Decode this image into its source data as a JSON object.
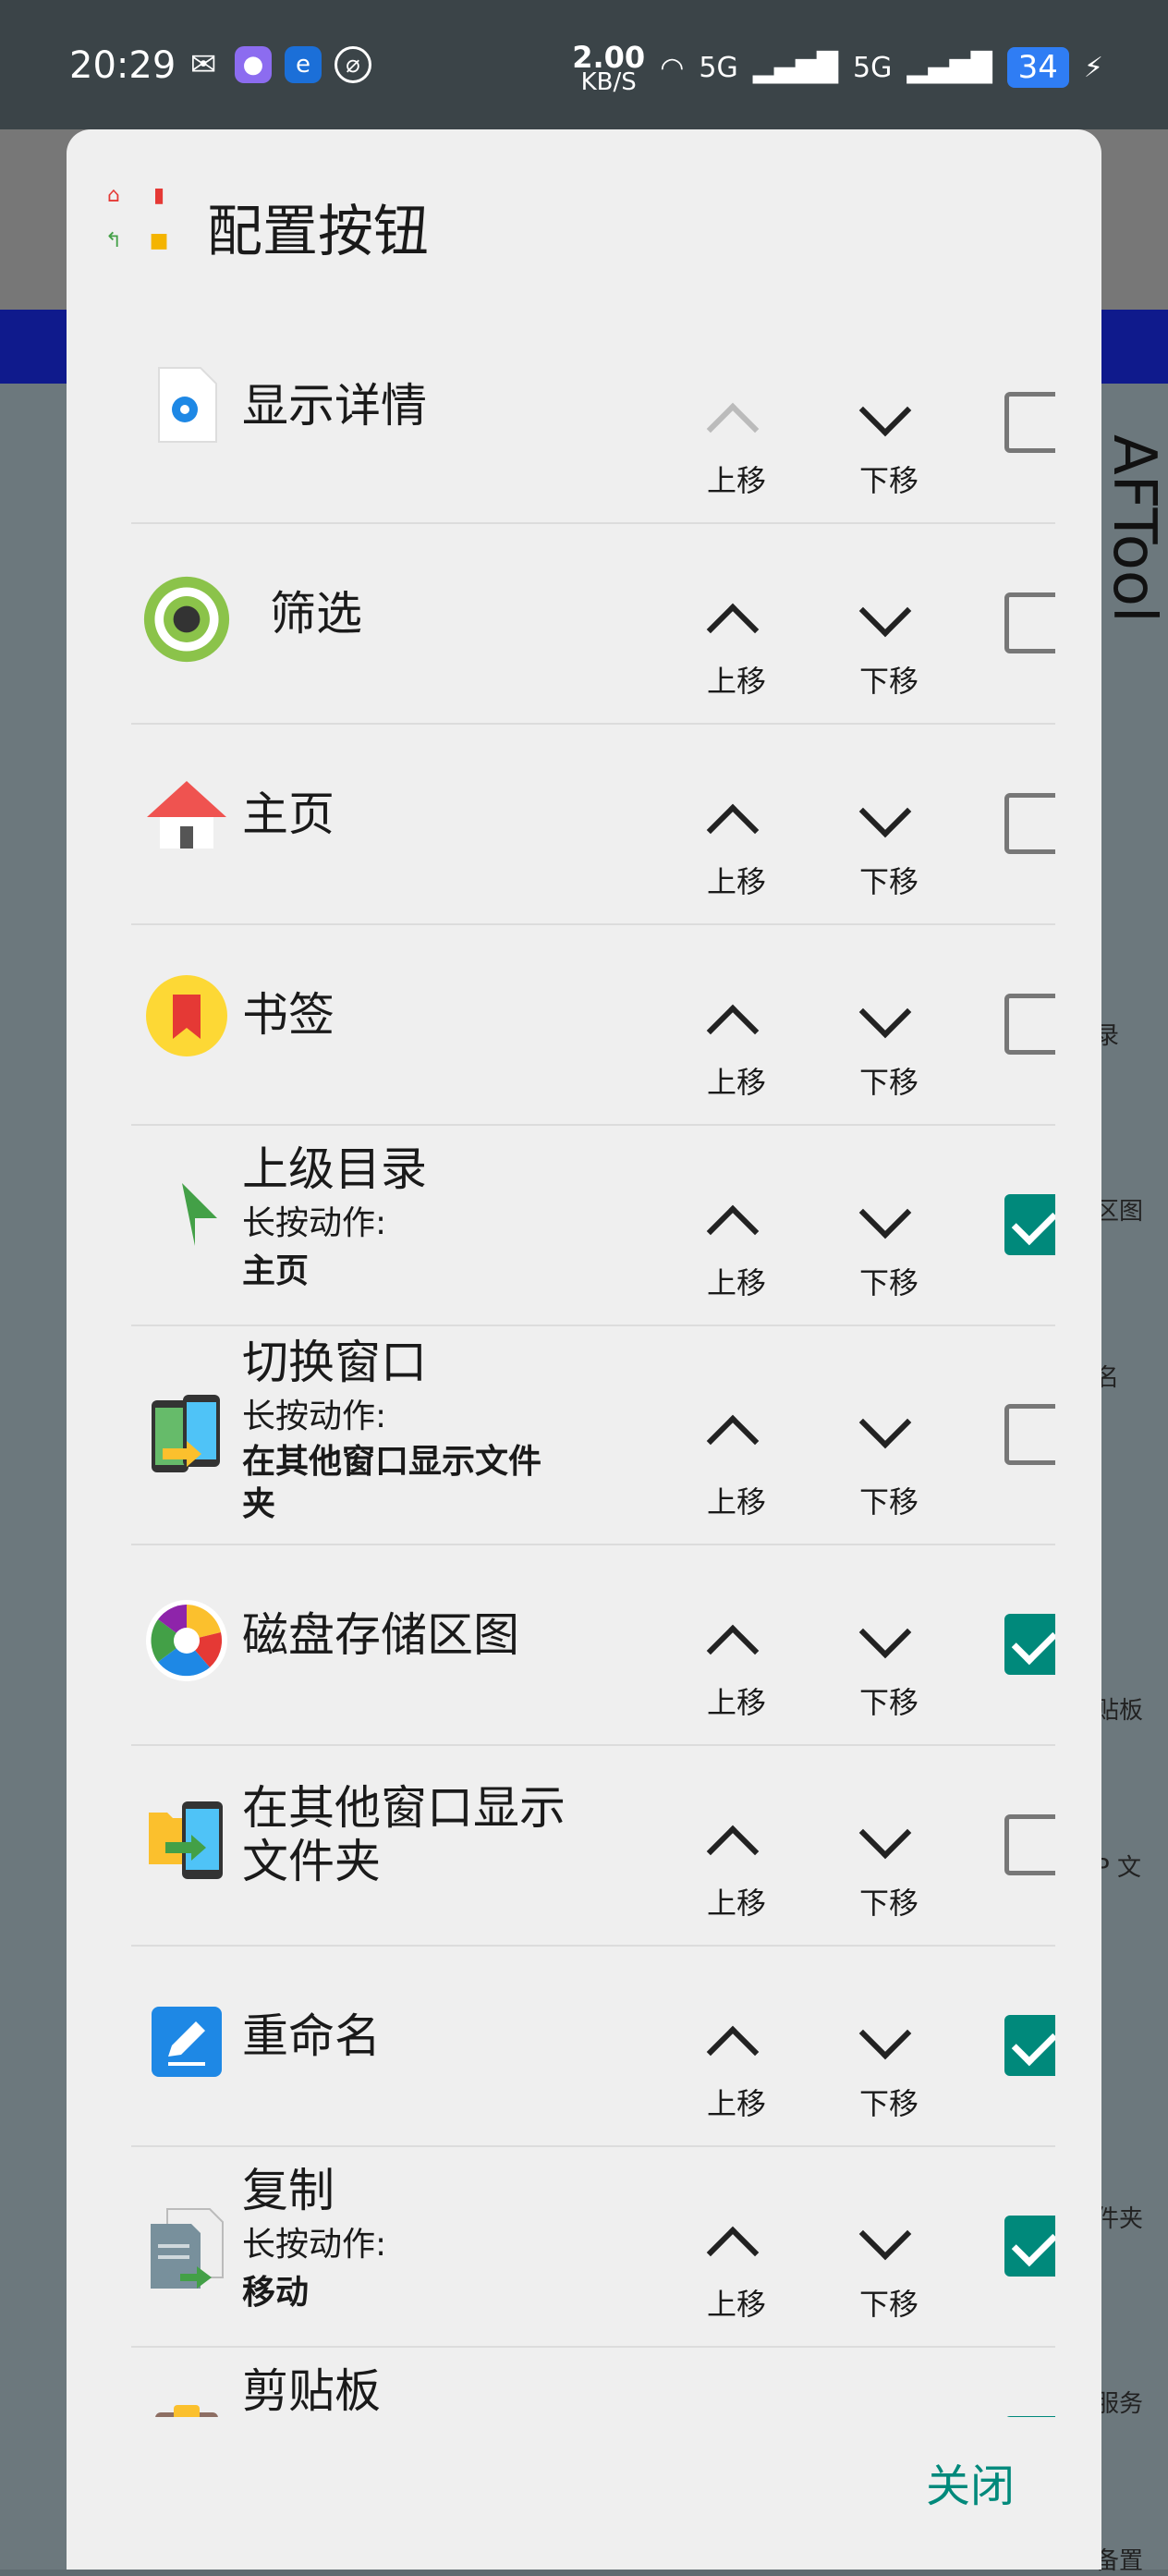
{
  "status": {
    "time": "20:29",
    "net_value": "2.00",
    "net_unit": "KB/S",
    "signal1": "5G",
    "signal2": "5G",
    "battery": "34"
  },
  "background": {
    "title": "AFTool",
    "side_labels": [
      "录",
      "区图",
      "名",
      "贴板",
      "P 文",
      "件夹",
      "服务",
      "备置"
    ]
  },
  "dialog": {
    "title": "配置按钮",
    "close_label": "关闭"
  },
  "labels": {
    "up": "上移",
    "down": "下移"
  },
  "rows": [
    {
      "title": "显示详情",
      "sub_label": "",
      "sub_value": "",
      "checked": false,
      "up_disabled": true,
      "icon": "info-icon"
    },
    {
      "title": "筛选",
      "sub_label": "",
      "sub_value": "",
      "checked": false,
      "up_disabled": false,
      "icon": "target-icon"
    },
    {
      "title": "主页",
      "sub_label": "",
      "sub_value": "",
      "checked": false,
      "up_disabled": false,
      "icon": "home-icon"
    },
    {
      "title": "书签",
      "sub_label": "",
      "sub_value": "",
      "checked": false,
      "up_disabled": false,
      "icon": "bookmark-icon"
    },
    {
      "title": "上级目录",
      "sub_label": "长按动作:",
      "sub_value": "主页",
      "checked": true,
      "up_disabled": false,
      "icon": "parent-dir-icon"
    },
    {
      "title": "切换窗口",
      "sub_label": "长按动作:",
      "sub_value": "在其他窗口显示文件夹",
      "checked": false,
      "up_disabled": false,
      "icon": "switch-window-icon"
    },
    {
      "title": "磁盘存储区图",
      "sub_label": "",
      "sub_value": "",
      "checked": true,
      "up_disabled": false,
      "icon": "disk-map-icon"
    },
    {
      "title": "在其他窗口显示文件夹",
      "sub_label": "",
      "sub_value": "",
      "checked": false,
      "up_disabled": false,
      "icon": "open-in-other-window-icon"
    },
    {
      "title": "重命名",
      "sub_label": "",
      "sub_value": "",
      "checked": true,
      "up_disabled": false,
      "icon": "rename-icon"
    },
    {
      "title": "复制",
      "sub_label": "长按动作:",
      "sub_value": "移动",
      "checked": true,
      "up_disabled": false,
      "icon": "copy-icon"
    },
    {
      "title": "剪贴板",
      "sub_label": "",
      "sub_value": "",
      "checked": true,
      "up_disabled": false,
      "icon": "clipboard-icon"
    }
  ]
}
